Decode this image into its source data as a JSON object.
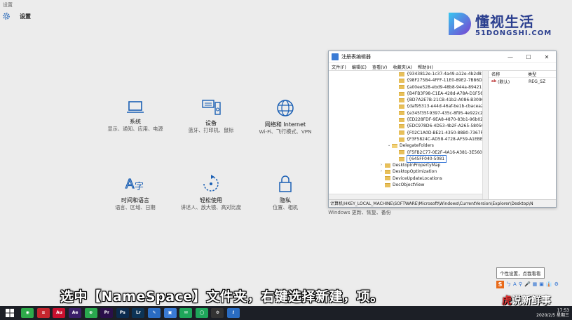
{
  "window": {
    "title": "设置"
  },
  "header": {
    "title": "设置"
  },
  "tiles": [
    {
      "title": "系统",
      "desc": "显示、通知、应用、电源",
      "icon": "laptop-icon"
    },
    {
      "title": "设备",
      "desc": "蓝牙、打印机、鼠标",
      "icon": "devices-icon"
    },
    {
      "title": "网络和 Internet",
      "desc": "Wi-Fi、飞行模式、VPN",
      "icon": "globe-icon"
    },
    {
      "title": "时间和语言",
      "desc": "语言、区域、日期",
      "icon": "time-language-icon"
    },
    {
      "title": "轻松使用",
      "desc": "讲述人、放大镜、高对比度",
      "icon": "ease-of-access-icon"
    },
    {
      "title": "隐私",
      "desc": "位置、相机",
      "icon": "lock-icon"
    }
  ],
  "behind": {
    "update": "Windows 更新、恢复、备份"
  },
  "regedit": {
    "title": "注册表编辑器",
    "controls": [
      "—",
      "☐",
      "✕"
    ],
    "menu": [
      "文件(F)",
      "编辑(E)",
      "查看(V)",
      "收藏夹(A)",
      "帮助(H)"
    ],
    "tree": [
      {
        "label": "{9343812e-1c37-4a49-a12e-4b2d810",
        "indent": 2,
        "caret": ""
      },
      {
        "label": "{98F275B4-4FFF-11E0-89E2-7B86DFF",
        "indent": 2,
        "caret": ""
      },
      {
        "label": "{a00ee528-ebd9-48b8-944a-894211",
        "indent": 2,
        "caret": ""
      },
      {
        "label": "{B4FB3F98-C1EA-428d-A78A-D1F56",
        "indent": 2,
        "caret": ""
      },
      {
        "label": "{BD7A2E7B-21CB-41b2-A086-B309684",
        "indent": 2,
        "caret": ""
      },
      {
        "label": "{daf95313-e44d-46af-be1b-cbacea2",
        "indent": 2,
        "caret": ""
      },
      {
        "label": "{e345f35f-9397-435c-8f95-4e922c26",
        "indent": 2,
        "caret": ""
      },
      {
        "label": "{ED228FDF-9EA8-4870-83b1-96b02C",
        "indent": 2,
        "caret": ""
      },
      {
        "label": "{EDC978D6-4D53-4b2F-A265-5805674",
        "indent": 2,
        "caret": ""
      },
      {
        "label": "{F02C1A0D-BE21-4350-88B0-7367FC",
        "indent": 2,
        "caret": ""
      },
      {
        "label": "{F3F5824C-AD58-4728-AF59-A1EBE3",
        "indent": 2,
        "caret": ""
      },
      {
        "label": "DelegateFolders",
        "indent": 1,
        "caret": "⌄",
        "open": true
      },
      {
        "label": "{F5FB2C77-0E2F-4A16-A381-3E560",
        "indent": 2,
        "caret": ""
      },
      {
        "label": "{645FF040-5081",
        "indent": 2,
        "caret": "",
        "editing": true
      },
      {
        "label": "DesktopInPropertyMap",
        "indent": 0,
        "caret": "›"
      },
      {
        "label": "DesktopOptimization",
        "indent": 0,
        "caret": "›"
      },
      {
        "label": "DeviceUpdateLocations",
        "indent": 0,
        "caret": ""
      },
      {
        "label": "DocObjectView",
        "indent": 0,
        "caret": ""
      }
    ],
    "columns": {
      "name": "名称",
      "type": "类型"
    },
    "values": [
      {
        "name": "(默认)",
        "type": "REG_SZ"
      }
    ],
    "status": "计算机\\HKEY_LOCAL_MACHINE\\SOFTWARE\\Microsoft\\Windows\\CurrentVersion\\Explorer\\Desktop\\N"
  },
  "watermark": {
    "cn": "懂视生活",
    "en": "51DONGSHI.COM"
  },
  "subtitle": "选中【NameSpace】文件夹，右键选择新建，项。",
  "brand": {
    "red": "虎",
    "rest": "说新鲜事"
  },
  "tooltip": "个性设置，点我看看",
  "ime": {
    "logo": "S",
    "items": [
      "ㄅ",
      "A",
      "⚲",
      "🎤",
      "▦",
      "▣",
      "👔",
      "⚙"
    ]
  },
  "taskbar": {
    "icons": [
      {
        "label": "◉",
        "color": "#2eaa4a"
      },
      {
        "label": "≡",
        "color": "#c4262e"
      },
      {
        "label": "Au",
        "color": "#c8102e"
      },
      {
        "label": "Ae",
        "color": "#3b1f69"
      },
      {
        "label": "⊕",
        "color": "#2aa94e"
      },
      {
        "label": "Pr",
        "color": "#2a0f4a"
      },
      {
        "label": "Ps",
        "color": "#0b2b4e"
      },
      {
        "label": "Lr",
        "color": "#0c3355"
      },
      {
        "label": "✎",
        "color": "#2a6cc2"
      },
      {
        "label": "▣",
        "color": "#3a7bd5"
      },
      {
        "label": "✉",
        "color": "#1ea65a"
      },
      {
        "label": "◯",
        "color": "#1ea65a"
      },
      {
        "label": "⚙",
        "color": "#333"
      },
      {
        "label": "ℓ",
        "color": "#2a6cc2"
      }
    ],
    "time": "17:53",
    "date": "2020/2/5 星期三"
  }
}
